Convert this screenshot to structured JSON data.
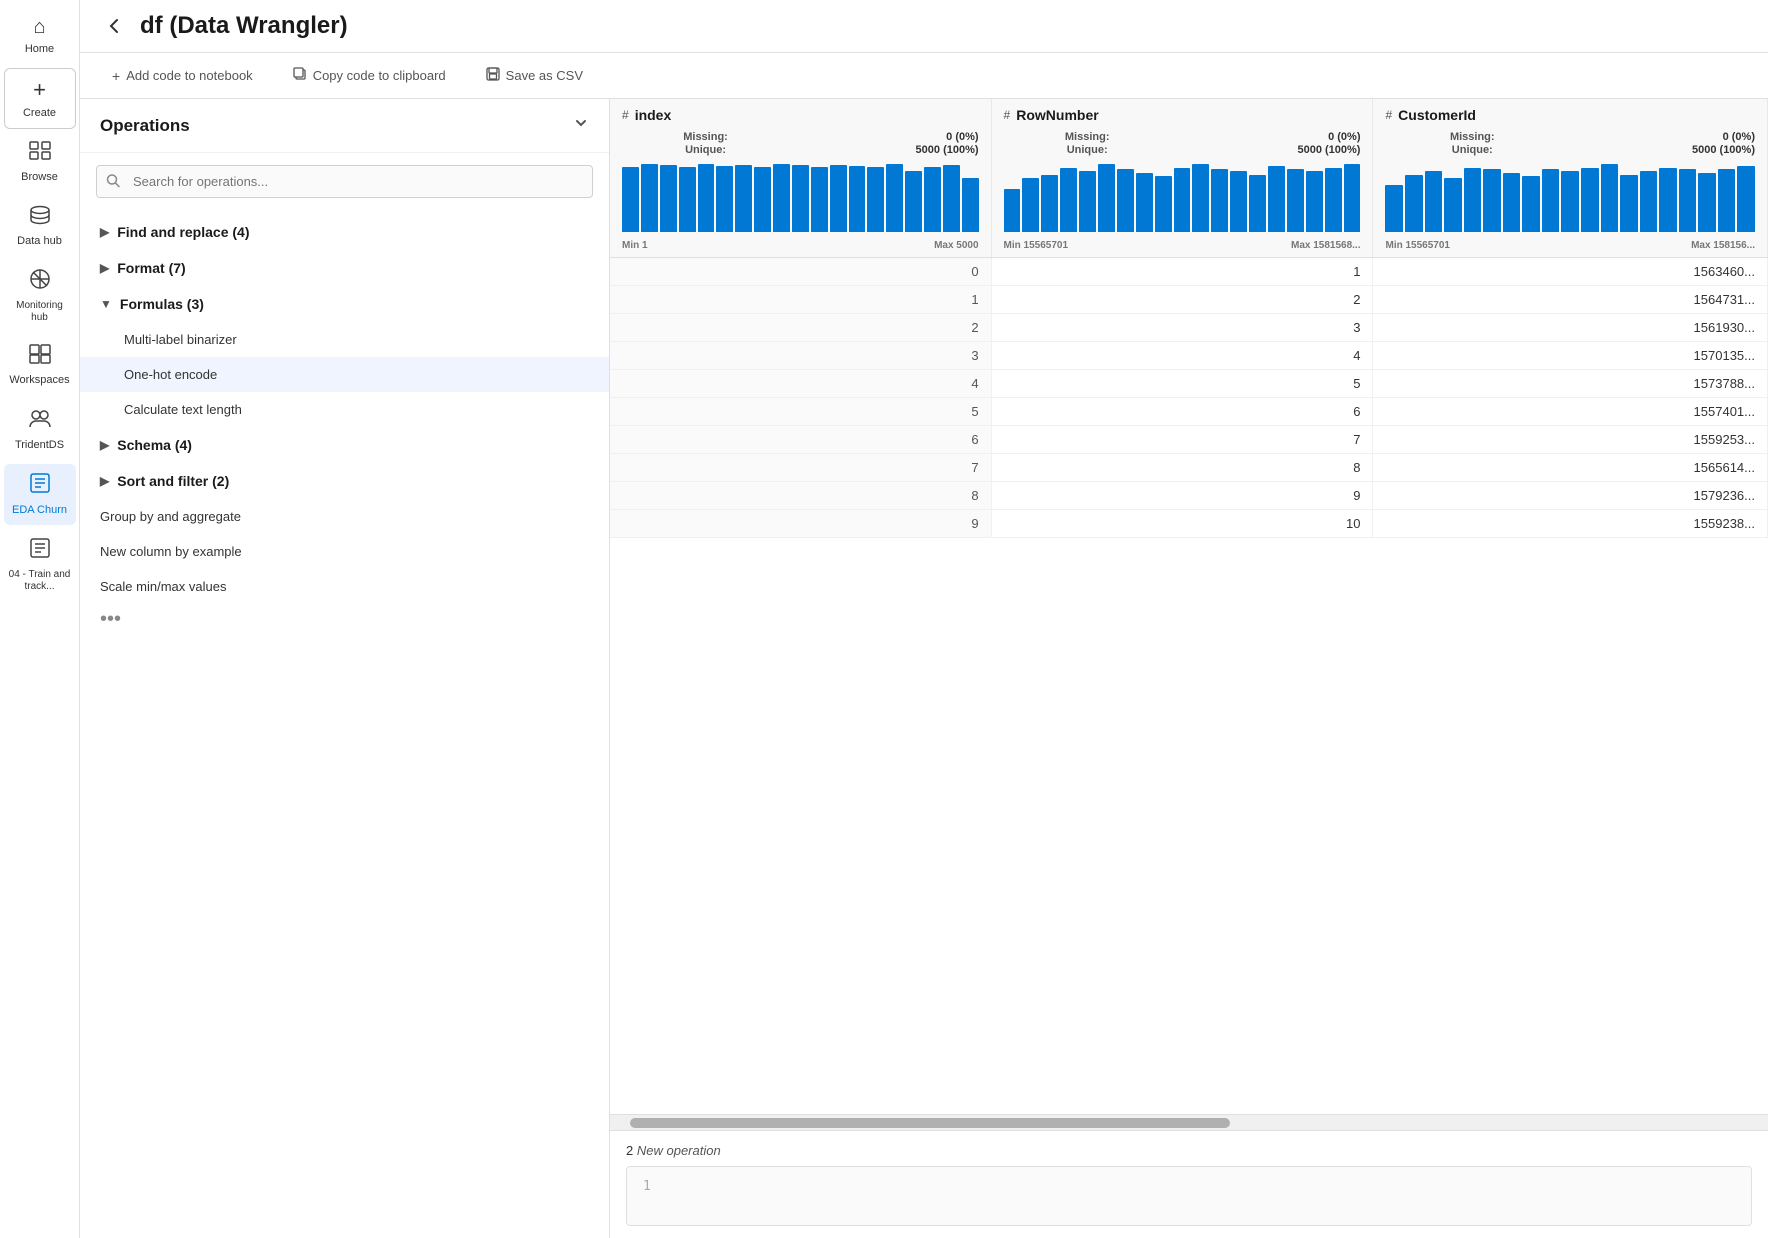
{
  "sidebar": {
    "items": [
      {
        "id": "home",
        "icon": "⌂",
        "label": "Home"
      },
      {
        "id": "create",
        "icon": "+",
        "label": "Create",
        "isCreate": true
      },
      {
        "id": "browse",
        "icon": "📁",
        "label": "Browse"
      },
      {
        "id": "datahub",
        "icon": "🗄",
        "label": "Data hub"
      },
      {
        "id": "monitoring",
        "icon": "⊘",
        "label": "Monitoring hub"
      },
      {
        "id": "workspaces",
        "icon": "▦",
        "label": "Workspaces"
      },
      {
        "id": "tridentds",
        "icon": "👥",
        "label": "TridentDS"
      },
      {
        "id": "edachurn",
        "icon": "📋",
        "label": "EDA Churn",
        "active": true
      },
      {
        "id": "train",
        "icon": "📋",
        "label": "04 - Train and track..."
      }
    ]
  },
  "header": {
    "title": "df (Data Wrangler)"
  },
  "toolbar": {
    "add_code_label": "Add code to notebook",
    "copy_code_label": "Copy code to clipboard",
    "save_csv_label": "Save as CSV"
  },
  "operations": {
    "title": "Operations",
    "search_placeholder": "Search for operations...",
    "groups": [
      {
        "id": "find-replace",
        "label": "Find and replace (4)",
        "expanded": false
      },
      {
        "id": "format",
        "label": "Format (7)",
        "expanded": false
      },
      {
        "id": "formulas",
        "label": "Formulas (3)",
        "expanded": true,
        "items": [
          {
            "id": "multi-label",
            "label": "Multi-label binarizer",
            "active": false
          },
          {
            "id": "one-hot",
            "label": "One-hot encode",
            "active": true
          },
          {
            "id": "calc-text",
            "label": "Calculate text length",
            "active": false
          }
        ]
      },
      {
        "id": "schema",
        "label": "Schema (4)",
        "expanded": false
      },
      {
        "id": "sort-filter",
        "label": "Sort and filter (2)",
        "expanded": false
      }
    ],
    "extra_items": [
      {
        "id": "group-agg",
        "label": "Group by and aggregate"
      },
      {
        "id": "new-col",
        "label": "New column by example"
      },
      {
        "id": "scale-minmax",
        "label": "Scale min/max values"
      }
    ]
  },
  "table": {
    "columns": [
      {
        "id": "index",
        "type": "#",
        "name": "index",
        "missing": "0 (0%)",
        "unique": "5000 (100%)",
        "min_label": "Min 1",
        "max_label": "Max 5000",
        "bars": [
          95,
          100,
          98,
          95,
          100,
          97,
          99,
          95,
          100,
          98,
          95,
          99,
          97,
          95,
          100,
          90,
          95,
          98,
          80
        ]
      },
      {
        "id": "rownumber",
        "type": "#",
        "name": "RowNumber",
        "missing": "0 (0%)",
        "unique": "5000 (100%)",
        "min_label": "Min 15565701",
        "max_label": "Max 158156...",
        "bars": [
          60,
          75,
          80,
          90,
          85,
          95,
          88,
          82,
          78,
          90,
          95,
          88,
          85,
          80,
          92,
          88,
          85,
          90,
          95
        ]
      },
      {
        "id": "customerid",
        "type": "#",
        "name": "CustomerId",
        "missing": "0 (0%)",
        "unique": "5000 (100%)",
        "min_label": "Min 15565701",
        "max_label": "Max 158156...",
        "bars": [
          65,
          80,
          85,
          75,
          90,
          88,
          82,
          78,
          88,
          85,
          90,
          95,
          80,
          85,
          90,
          88,
          82,
          88,
          92
        ]
      }
    ],
    "rows": [
      {
        "index": 0,
        "rownumber": 1,
        "customerid": "1563460..."
      },
      {
        "index": 1,
        "rownumber": 2,
        "customerid": "1564731..."
      },
      {
        "index": 2,
        "rownumber": 3,
        "customerid": "1561930..."
      },
      {
        "index": 3,
        "rownumber": 4,
        "customerid": "1570135..."
      },
      {
        "index": 4,
        "rownumber": 5,
        "customerid": "1573788..."
      },
      {
        "index": 5,
        "rownumber": 6,
        "customerid": "1557401..."
      },
      {
        "index": 6,
        "rownumber": 7,
        "customerid": "1559253..."
      },
      {
        "index": 7,
        "rownumber": 8,
        "customerid": "1565614..."
      },
      {
        "index": 8,
        "rownumber": 9,
        "customerid": "1579236..."
      },
      {
        "index": 9,
        "rownumber": 10,
        "customerid": "1559238..."
      }
    ]
  },
  "new_operation": {
    "number": "2",
    "label": "New operation",
    "code_line": "1",
    "code_content": ""
  }
}
